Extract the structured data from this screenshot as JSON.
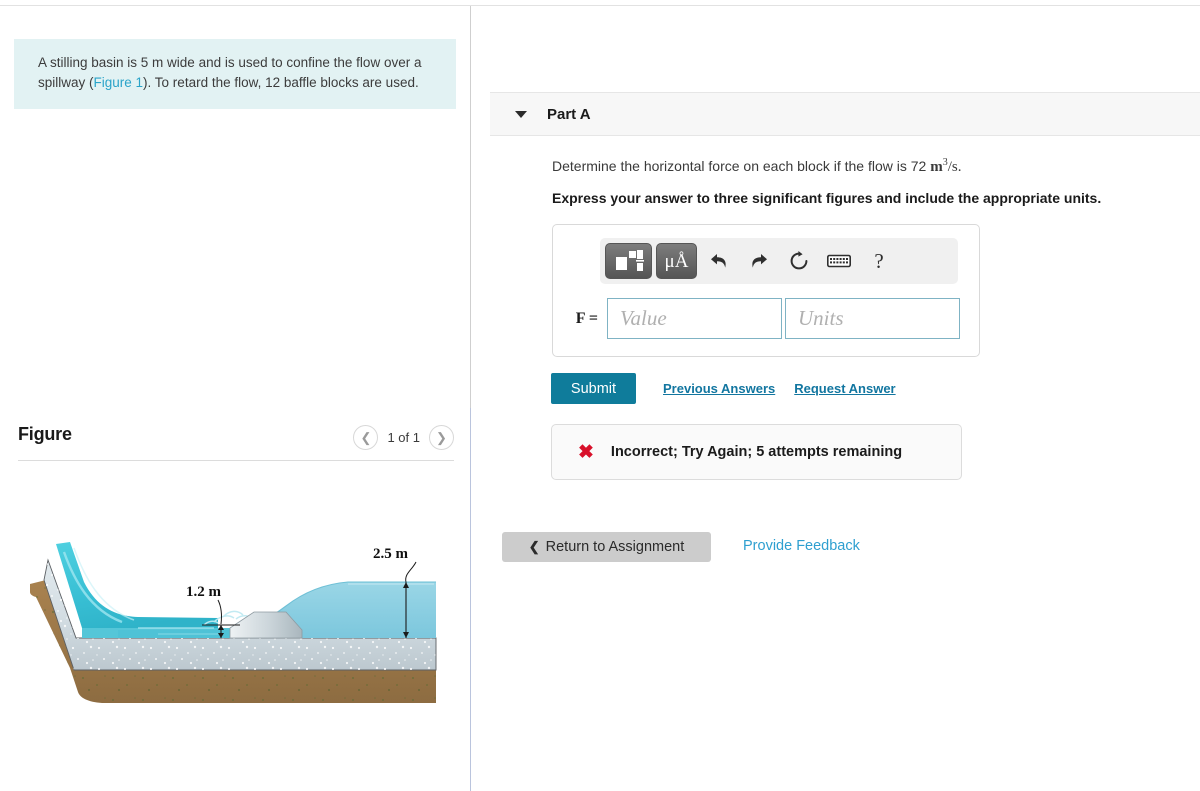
{
  "problem": {
    "text_before_link": "A stilling basin is 5 m wide and is used to confine the flow over a spillway (",
    "link_label": "Figure 1",
    "text_after_link": "). To retard the flow, 12 baffle blocks are used."
  },
  "figure_panel": {
    "title": "Figure",
    "prev_icon": "chevron-left-icon",
    "counter": "1 of 1",
    "next_icon": "chevron-right-icon",
    "diagram": {
      "description": "Spillway discharging into a stilling basin with a baffle block on a concrete apron over soil",
      "labels": [
        {
          "text": "1.2 m",
          "meaning": "upstream supercritical flow depth"
        },
        {
          "text": "2.5 m",
          "meaning": "downstream subcritical flow depth"
        }
      ],
      "colors": {
        "water_upstream": "#3fc4d8",
        "water_downstream": "#8fd0e2",
        "concrete": "#cfd9de",
        "soil": "#9c7849",
        "block": "#c9d2d7"
      }
    }
  },
  "part": {
    "caret_icon": "caret-down-icon",
    "title": "Part A",
    "question_prefix": "Determine the horizontal force on each block if the flow is 72 ",
    "question_unit_base": "m",
    "question_unit_exponent": "3",
    "question_unit_suffix": "/s.",
    "instruction": "Express your answer to three significant figures and include the appropriate units."
  },
  "answer_card": {
    "toolbar": [
      {
        "name": "math-template-icon",
        "glyph": ""
      },
      {
        "name": "units-micro-angstrom-icon",
        "glyph": "μÅ"
      },
      {
        "name": "undo-icon",
        "glyph": "↰"
      },
      {
        "name": "redo-icon",
        "glyph": "↱"
      },
      {
        "name": "reset-icon",
        "glyph": "↻"
      },
      {
        "name": "keyboard-icon",
        "glyph": "⌨"
      },
      {
        "name": "help-icon",
        "glyph": "?"
      }
    ],
    "variable_label": "F =",
    "value_placeholder": "Value",
    "units_placeholder": "Units",
    "value_current": "",
    "units_current": ""
  },
  "actions": {
    "submit_label": "Submit",
    "previous_answers_label": "Previous Answers",
    "request_answer_label": "Request Answer"
  },
  "feedback": {
    "status_icon": "error-x-icon",
    "message": "Incorrect; Try Again; 5 attempts remaining"
  },
  "footer": {
    "return_icon": "chevron-left-icon",
    "return_label": "Return to Assignment",
    "provide_feedback_label": "Provide Feedback"
  },
  "colors": {
    "problem_bg": "#e2f2f3",
    "accent_teal": "#0f7c9b",
    "link_blue": "#1276a0",
    "error_red": "#d8102a",
    "header_bg": "#f7f7f7"
  }
}
